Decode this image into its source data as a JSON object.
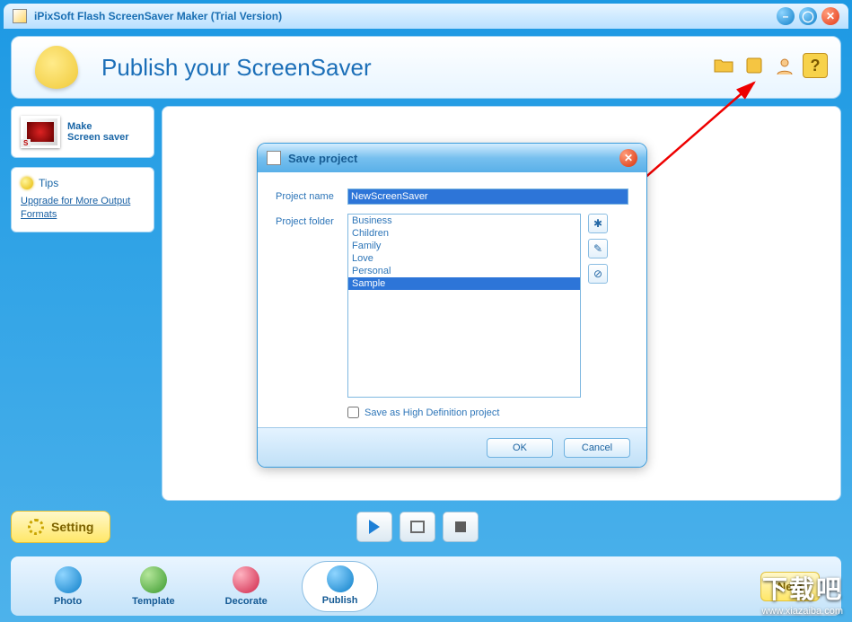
{
  "title": "iPixSoft Flash ScreenSaver Maker (Trial Version)",
  "header": {
    "title": "Publish your ScreenSaver"
  },
  "sidebar": {
    "make_saver": {
      "line1": "Make",
      "line2": "Screen saver"
    },
    "tips": {
      "heading": "Tips",
      "link": "Upgrade for More Output Formats"
    }
  },
  "dialog": {
    "title": "Save project",
    "labels": {
      "name": "Project name",
      "folder": "Project folder"
    },
    "name_value": "NewScreenSaver",
    "folders": [
      "Business",
      "Children",
      "Family",
      "Love",
      "Personal",
      "Sample"
    ],
    "selected_folder_index": 5,
    "checkbox": "Save as High Definition project",
    "buttons": {
      "ok": "OK",
      "cancel": "Cancel"
    }
  },
  "setting_btn": "Setting",
  "nav": {
    "tabs": [
      "Photo",
      "Template",
      "Decorate",
      "Publish"
    ],
    "active_index": 3,
    "next": "Next"
  },
  "watermark": {
    "big": "下载吧",
    "small": "www.xiazaiba.com"
  }
}
